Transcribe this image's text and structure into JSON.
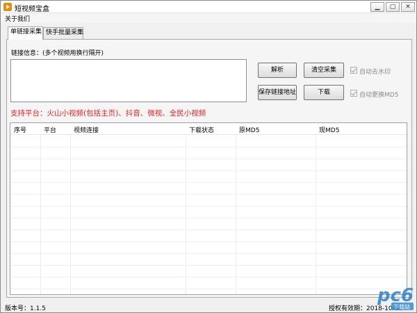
{
  "window": {
    "title": "短视频宝盒"
  },
  "menu": {
    "items": [
      "关于我们"
    ]
  },
  "tabs": [
    {
      "label": "单链接采集",
      "active": true
    },
    {
      "label": "快手批量采集",
      "active": false
    }
  ],
  "link_input": {
    "label": "链接信息：(多个视频用换行隔开)",
    "value": ""
  },
  "buttons": {
    "parse": "解析",
    "clear": "清空采集",
    "save": "保存链接地址",
    "download": "下载"
  },
  "checkboxes": [
    {
      "label": "自动去水印",
      "checked": true,
      "enabled": false
    },
    {
      "label": "自动更换MD5",
      "checked": true,
      "enabled": false
    }
  ],
  "platforms_text": "支持平台：火山小视频(包括主页)、抖音、微视、全民小视频",
  "table": {
    "columns": [
      "序号",
      "平台",
      "视频连接",
      "下载状态",
      "原MD5",
      "现MD5"
    ],
    "rows": []
  },
  "status": {
    "version": "版本号：1.1.5",
    "license": "授权有效期：2018-10-18"
  },
  "watermark": {
    "text": "pc6",
    "sub": "下载站"
  },
  "colors": {
    "platform_text": "#e32020",
    "accent_icon": "#e8900c",
    "watermark": "#2b82c9"
  }
}
